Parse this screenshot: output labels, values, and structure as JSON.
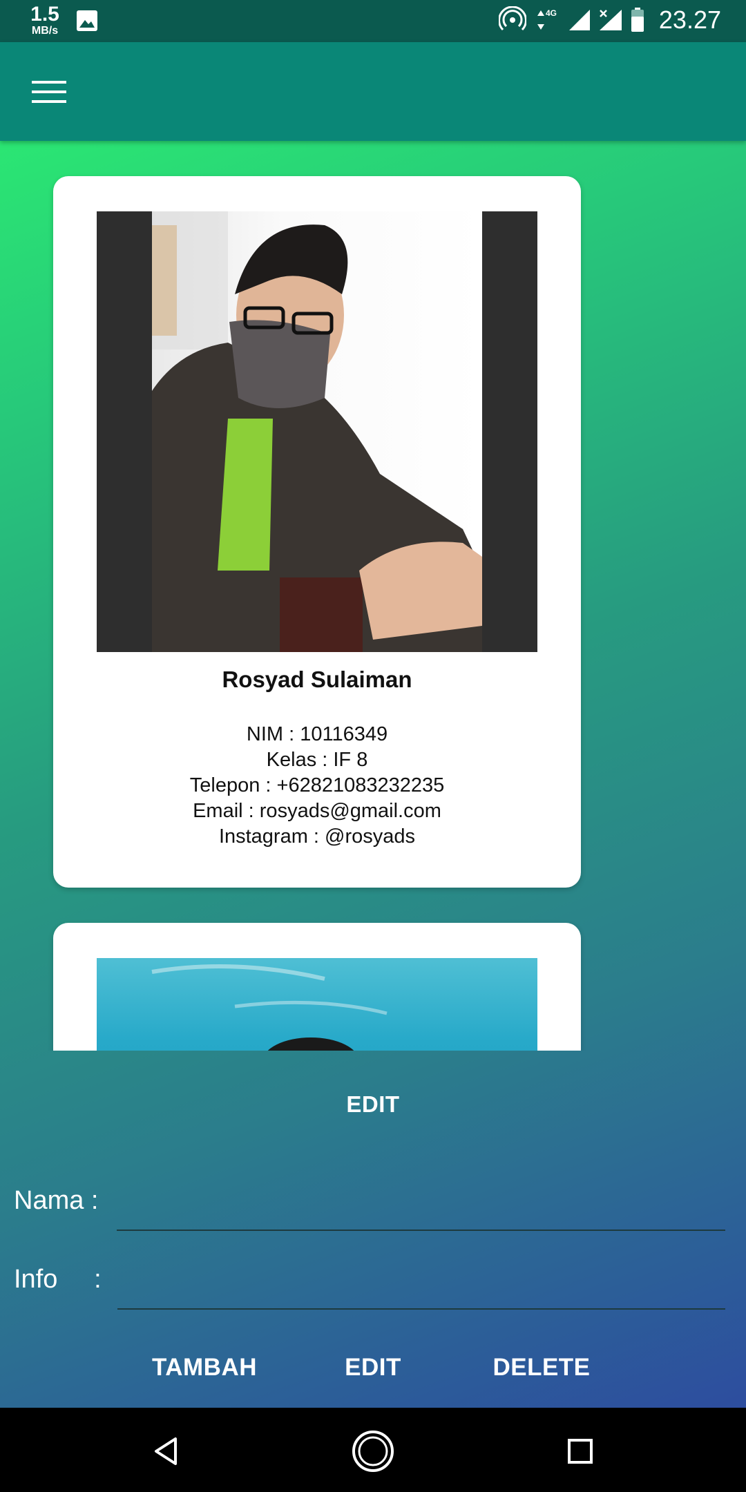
{
  "status_bar": {
    "speed_value": "1.5",
    "speed_unit": "MB/s",
    "network": "4G",
    "time": "23.27",
    "icons": [
      "gallery-icon",
      "hotspot-icon",
      "data-arrows-icon",
      "signal-icon",
      "signal-no-service-icon",
      "battery-icon"
    ]
  },
  "app_bar": {
    "menu_icon": "hamburger-menu-icon"
  },
  "cards": [
    {
      "name": "Rosyad Sulaiman",
      "nim": "NIM : 10116349",
      "kelas": "Kelas : IF 8",
      "telepon": "Telepon : +62821083232235",
      "email": "Email : rosyads@gmail.com",
      "instagram": "Instagram : @rosyads"
    }
  ],
  "form": {
    "title": "EDIT",
    "nama_label": "Nama :",
    "info_label": "Info     :",
    "nama_value": "",
    "info_value": ""
  },
  "buttons": {
    "tambah": "TAMBAH",
    "edit": "EDIT",
    "delete": "DELETE"
  },
  "nav": {
    "back": "back-icon",
    "home": "home-icon",
    "recent": "recent-apps-icon"
  }
}
